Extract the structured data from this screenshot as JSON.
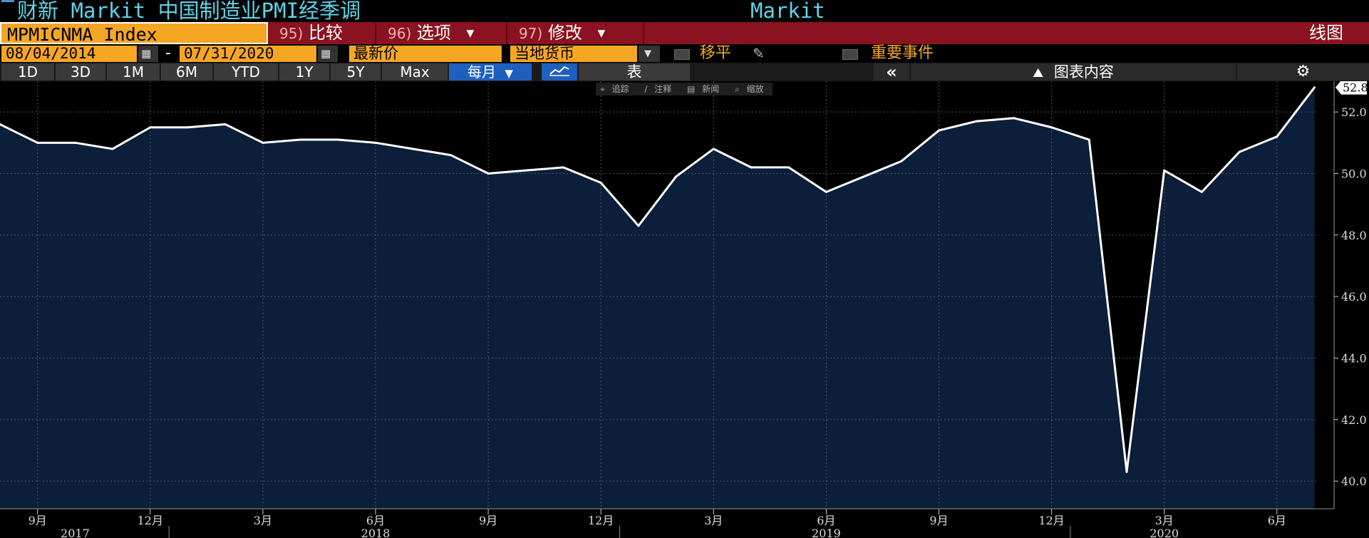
{
  "title": {
    "main": "财新 Markit 中国制造业PMI经季调",
    "source": "Markit"
  },
  "command_bar": {
    "ticker": "MPMICNMA Index",
    "compare": {
      "num": "95)",
      "label": "比较"
    },
    "options": {
      "num": "96)",
      "label": "选项"
    },
    "edit": {
      "num": "97)",
      "label": "修改"
    },
    "view_label": "线图"
  },
  "settings": {
    "start_date": "08/04/2014",
    "end_date": "07/31/2020",
    "dash": "-",
    "price_field": "最新价",
    "currency_field": "当地货币",
    "moving_avg_label": "移平",
    "events_label": "重要事件"
  },
  "range_bar": {
    "ranges": [
      "1D",
      "3D",
      "1M",
      "6M",
      "YTD",
      "1Y",
      "5Y",
      "Max"
    ],
    "frequency": "每月",
    "table_label": "表",
    "chart_content_label": "图表内容"
  },
  "mini_toolbar": [
    "追踪",
    "注释",
    "新闻",
    "缩放"
  ],
  "colors": {
    "line": "#ffffff",
    "area": "#0b1e3a",
    "grid": "#555555",
    "axis_text": "#dddddd"
  },
  "chart_data": {
    "type": "area",
    "x": [
      "2017-08",
      "2017-09",
      "2017-10",
      "2017-11",
      "2017-12",
      "2018-01",
      "2018-02",
      "2018-03",
      "2018-04",
      "2018-05",
      "2018-06",
      "2018-07",
      "2018-08",
      "2018-09",
      "2018-10",
      "2018-11",
      "2018-12",
      "2019-01",
      "2019-02",
      "2019-03",
      "2019-04",
      "2019-05",
      "2019-06",
      "2019-07",
      "2019-08",
      "2019-09",
      "2019-10",
      "2019-11",
      "2019-12",
      "2020-01",
      "2020-02",
      "2020-03",
      "2020-04",
      "2020-05",
      "2020-06",
      "2020-07"
    ],
    "values": [
      51.6,
      51.0,
      51.0,
      50.8,
      51.5,
      51.5,
      51.6,
      51.0,
      51.1,
      51.1,
      51.0,
      50.8,
      50.6,
      50.0,
      50.1,
      50.2,
      49.7,
      48.3,
      49.9,
      50.8,
      50.2,
      50.2,
      49.4,
      49.9,
      50.4,
      51.4,
      51.7,
      51.8,
      51.5,
      51.1,
      40.3,
      50.1,
      49.4,
      50.7,
      51.2,
      52.8
    ],
    "last_value_label": "52.8",
    "ylim": [
      39.1,
      53.0
    ],
    "y_ticks": [
      "40.0",
      "42.0",
      "44.0",
      "46.0",
      "48.0",
      "50.0",
      "52.0"
    ],
    "x_month_ticks": [
      {
        "label": "9月",
        "date": "2017-09"
      },
      {
        "label": "12月",
        "date": "2017-12"
      },
      {
        "label": "3月",
        "date": "2018-03"
      },
      {
        "label": "6月",
        "date": "2018-06"
      },
      {
        "label": "9月",
        "date": "2018-09"
      },
      {
        "label": "12月",
        "date": "2018-12"
      },
      {
        "label": "3月",
        "date": "2019-03"
      },
      {
        "label": "6月",
        "date": "2019-06"
      },
      {
        "label": "9月",
        "date": "2019-09"
      },
      {
        "label": "12月",
        "date": "2019-12"
      },
      {
        "label": "3月",
        "date": "2020-03"
      },
      {
        "label": "6月",
        "date": "2020-06"
      }
    ],
    "x_year_ticks": [
      {
        "label": "2017",
        "date": "2017-10"
      },
      {
        "label": "2018",
        "date": "2018-06"
      },
      {
        "label": "2019",
        "date": "2019-06"
      },
      {
        "label": "2020",
        "date": "2020-03"
      }
    ],
    "grid": true
  }
}
